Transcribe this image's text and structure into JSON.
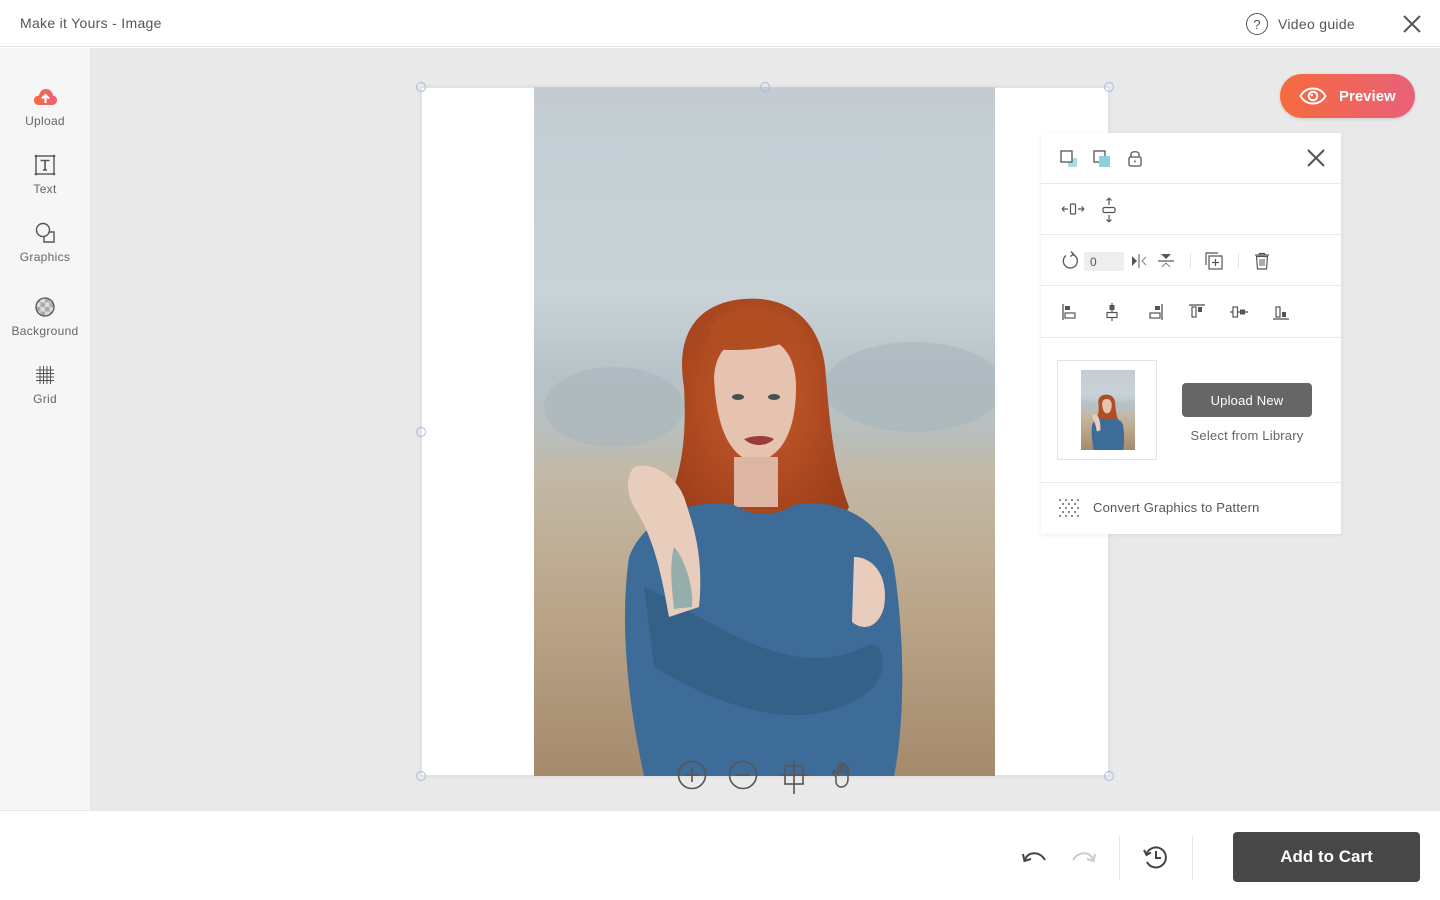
{
  "header": {
    "title": "Make it Yours - Image",
    "video_guide_label": "Video guide",
    "help_glyph": "?"
  },
  "sidebar": {
    "items": [
      {
        "id": "upload",
        "label": "Upload",
        "icon": "cloud-upload-icon"
      },
      {
        "id": "text",
        "label": "Text",
        "icon": "text-box-icon"
      },
      {
        "id": "graphics",
        "label": "Graphics",
        "icon": "shapes-icon"
      },
      {
        "id": "background",
        "label": "Background",
        "icon": "checker-circle-icon"
      },
      {
        "id": "grid",
        "label": "Grid",
        "icon": "grid-icon"
      }
    ]
  },
  "preview": {
    "label": "Preview"
  },
  "panel": {
    "rotation_value": "0",
    "upload_new_label": "Upload New",
    "select_library_label": "Select from Library",
    "convert_pattern_label": "Convert Graphics to Pattern"
  },
  "canvas_tools": [
    "zoom-in",
    "zoom-out",
    "crop",
    "pan"
  ],
  "footer": {
    "add_to_cart_label": "Add to Cart"
  },
  "colors": {
    "accent_start": "#f76a3c",
    "accent_end": "#e8617a",
    "upload_icon": "#f0624a",
    "cart_bg": "#474747",
    "handle": "#a9b8e6"
  }
}
